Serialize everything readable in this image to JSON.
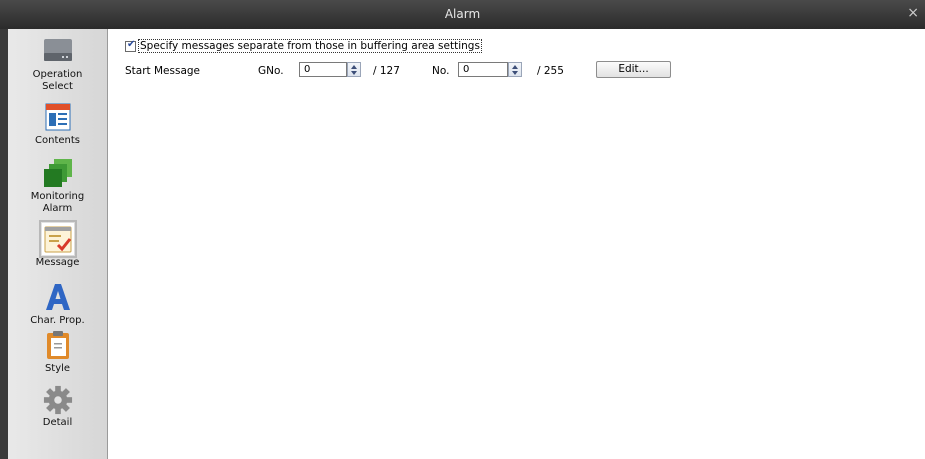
{
  "window": {
    "title": "Alarm",
    "close_glyph": "×"
  },
  "sidebar": {
    "items": [
      {
        "label_line1": "Operation",
        "label_line2": "Select",
        "icon": "hard-drive-icon",
        "active": false
      },
      {
        "label_line1": "Contents",
        "label_line2": "",
        "icon": "document-list-icon",
        "active": false
      },
      {
        "label_line1": "Monitoring",
        "label_line2": "Alarm",
        "icon": "stacked-squares-icon",
        "active": false
      },
      {
        "label_line1": "Message",
        "label_line2": "",
        "icon": "message-check-icon",
        "active": true
      },
      {
        "label_line1": "Char. Prop.",
        "label_line2": "",
        "icon": "letter-a-icon",
        "active": false
      },
      {
        "label_line1": "Style",
        "label_line2": "",
        "icon": "clipboard-icon",
        "active": false
      },
      {
        "label_line1": "Detail",
        "label_line2": "",
        "icon": "gear-icon",
        "active": false
      }
    ]
  },
  "main": {
    "separate_checkbox": {
      "checked": true,
      "label": "Specify messages separate from those in buffering area settings"
    },
    "start_message": {
      "label": "Start Message",
      "gno_label": "GNo.",
      "gno_value": "0",
      "gno_max": "/ 127",
      "no_label": "No.",
      "no_value": "0",
      "no_max": "/ 255",
      "edit_button": "Edit..."
    }
  },
  "colors": {
    "titlebar": "#2b2b2b",
    "sidebar": "#e0e0e0",
    "accent_blue": "#2a4a9a"
  }
}
